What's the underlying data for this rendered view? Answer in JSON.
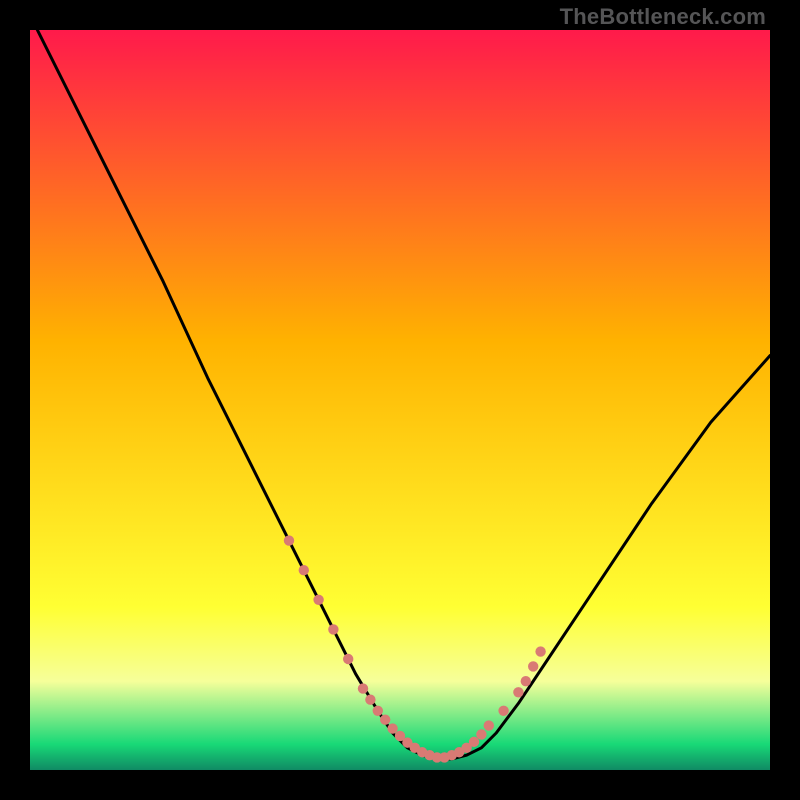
{
  "watermark": "TheBottleneck.com",
  "chart_data": {
    "type": "line",
    "title": "",
    "xlabel": "",
    "ylabel": "",
    "xlim": [
      0,
      100
    ],
    "ylim": [
      0,
      100
    ],
    "grid": false,
    "legend": false,
    "background_gradient": {
      "top": "#ff1a4b",
      "mid_upper": "#ffb200",
      "mid_lower": "#ffff33",
      "band": "#f6ff9a",
      "bottom": "#18d977",
      "edge": "#108a64"
    },
    "curve": {
      "description": "V-shaped bottleneck curve; high at left, dips to near-zero around x≈55, rises again to the right",
      "x": [
        1,
        6,
        12,
        18,
        24,
        30,
        35,
        40,
        44,
        47,
        49,
        51,
        53,
        55,
        57,
        59,
        61,
        63,
        66,
        70,
        76,
        84,
        92,
        100
      ],
      "y": [
        100,
        90,
        78,
        66,
        53,
        41,
        31,
        21,
        13,
        8,
        5,
        3,
        2,
        1.5,
        1.5,
        2,
        3,
        5,
        9,
        15,
        24,
        36,
        47,
        56
      ]
    },
    "highlight_dots": {
      "description": "Salmon dotted markers along the curve near the trough and partway up each arm",
      "color": "#d97a74",
      "x": [
        35,
        37,
        39,
        41,
        43,
        45,
        46,
        47,
        48,
        49,
        50,
        51,
        52,
        53,
        54,
        55,
        56,
        57,
        58,
        59,
        60,
        61,
        62,
        64,
        66,
        67,
        68,
        69
      ],
      "y": [
        31,
        27,
        23,
        19,
        15,
        11,
        9.5,
        8,
        6.8,
        5.6,
        4.6,
        3.7,
        3,
        2.4,
        2,
        1.7,
        1.7,
        2,
        2.4,
        3,
        3.8,
        4.8,
        6,
        8,
        10.5,
        12,
        14,
        16
      ]
    }
  }
}
